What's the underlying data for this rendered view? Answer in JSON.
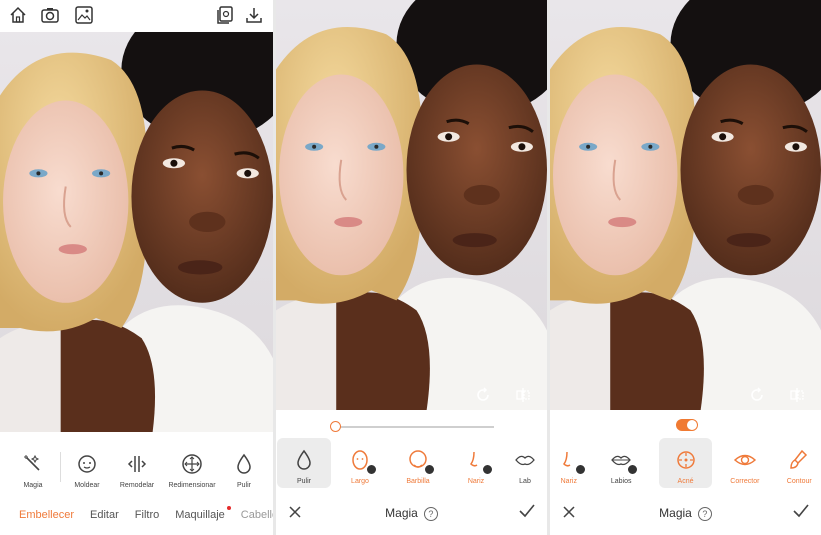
{
  "colors": {
    "accent": "#ef7a3a",
    "text": "#444444"
  },
  "panel1": {
    "toolbar_icons": [
      "home-icon",
      "camera-icon",
      "gallery-icon",
      "compare-icon",
      "download-icon"
    ],
    "tools": [
      {
        "label": "Magia",
        "icon": "magic-wand-icon"
      },
      {
        "label": "Moldear",
        "icon": "face-shape-icon"
      },
      {
        "label": "Remodelar",
        "icon": "reshape-icon"
      },
      {
        "label": "Redimensionar",
        "icon": "resize-icon"
      },
      {
        "label": "Pulir",
        "icon": "drop-icon"
      }
    ],
    "nav": [
      {
        "label": "Embellecer",
        "active": true
      },
      {
        "label": "Editar"
      },
      {
        "label": "Filtro"
      },
      {
        "label": "Maquillaje",
        "badge": true
      },
      {
        "label": "Cabello"
      }
    ]
  },
  "panel2": {
    "slider_value": 0,
    "tools": [
      {
        "label": "Pulir",
        "selected": true,
        "icon": "drop-icon"
      },
      {
        "label": "Largo",
        "checked": true,
        "icon": "face-long-icon"
      },
      {
        "label": "Barbilla",
        "checked": true,
        "icon": "chin-icon"
      },
      {
        "label": "Nariz",
        "checked": true,
        "icon": "nose-icon"
      },
      {
        "label": "Lab",
        "icon": "lips-icon"
      }
    ],
    "title": "Magia",
    "help": "?"
  },
  "panel3": {
    "toggle_on": true,
    "tools": [
      {
        "label": "Nariz",
        "checked": true,
        "icon": "nose-icon"
      },
      {
        "label": "Labios",
        "checked": true,
        "icon": "lips-icon"
      },
      {
        "label": "Acné",
        "selected": true,
        "icon": "acne-icon"
      },
      {
        "label": "Corrector",
        "icon": "eye-icon"
      },
      {
        "label": "Contour",
        "icon": "brush-icon"
      }
    ],
    "title": "Magia",
    "help": "?"
  }
}
